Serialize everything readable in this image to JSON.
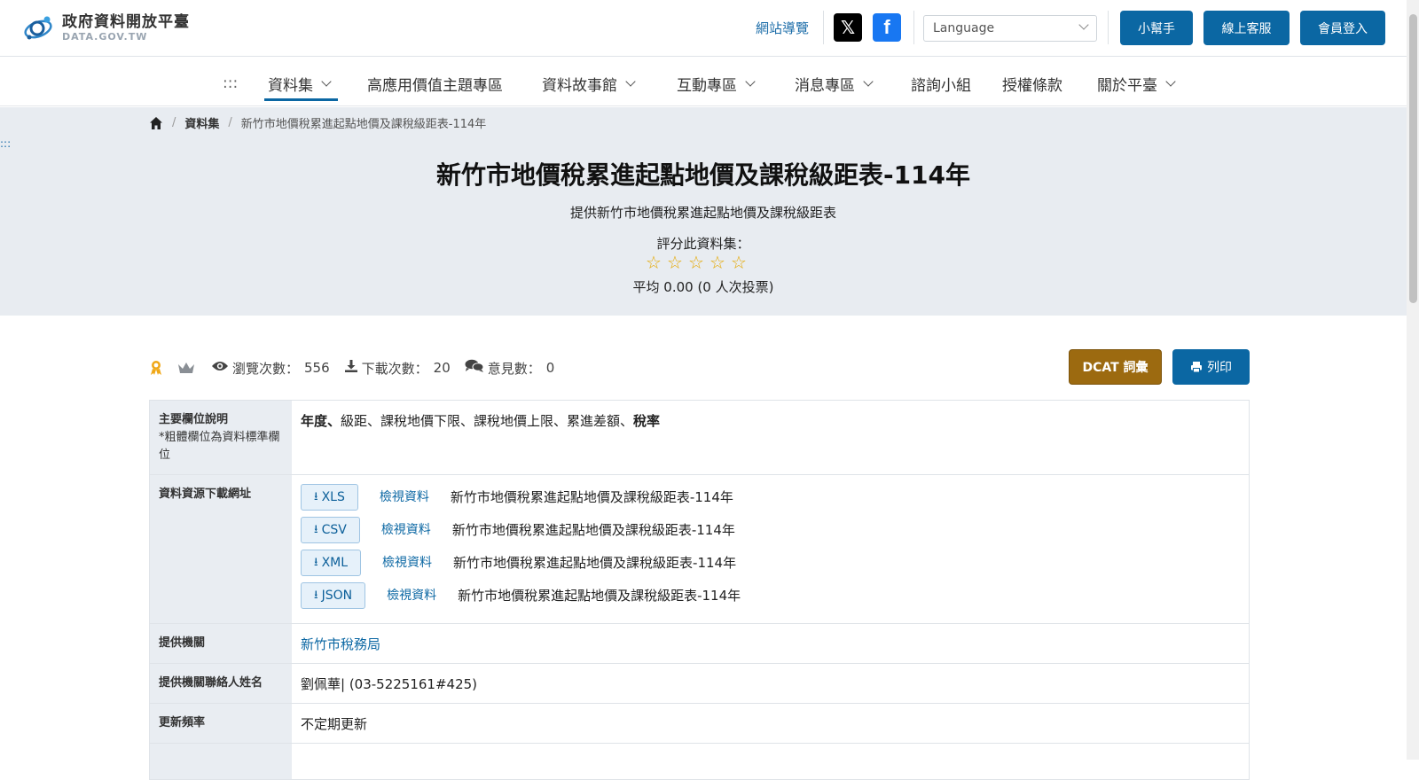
{
  "header": {
    "logo_zh": "政府資料開放平臺",
    "logo_en": "DATA.GOV.TW",
    "sitemap": "網站導覽",
    "social_x": "𝕏",
    "social_fb": "f",
    "language_placeholder": "Language",
    "btn_helper": "小幫手",
    "btn_service": "線上客服",
    "btn_login": "會員登入"
  },
  "nav": {
    "accesskey": ":::",
    "items": [
      "資料集",
      "高應用價值主題專區",
      "資料故事館",
      "互動專區",
      "消息專區",
      "諮詢小組",
      "授權條款",
      "關於平臺"
    ]
  },
  "breadcrumb": {
    "level1": "資料集",
    "current": "新竹市地價稅累進起點地價及課稅級距表-114年"
  },
  "skip_anchor": ":::",
  "hero": {
    "title": "新竹市地價稅累進起點地價及課稅級距表-114年",
    "description": "提供新竹市地價稅累進起點地價及課稅級距表",
    "rate_label": "評分此資料集：",
    "average": "平均 0.00 (0 人次投票)",
    "stars": 0
  },
  "stats": {
    "views_label": "瀏覽次數：",
    "views": "556",
    "downloads_label": "下載次數：",
    "downloads": "20",
    "comments_label": "意見數：",
    "comments": "0",
    "btn_dcat": "DCAT 詞彙",
    "btn_print": "列印"
  },
  "info": {
    "fields": {
      "label": "主要欄位說明",
      "sub": "*粗體欄位為資料標準欄位",
      "bold1": "年度",
      "sep1": "、",
      "plain": "級距、課稅地價下限、課稅地價上限、累進差額、",
      "bold2": "稅率"
    },
    "resources": {
      "label": "資料資源下載網址",
      "view_label": "檢視資料",
      "items": [
        {
          "format": "XLS",
          "title": "新竹市地價稅累進起點地價及課稅級距表-114年"
        },
        {
          "format": "CSV",
          "title": "新竹市地價稅累進起點地價及課稅級距表-114年"
        },
        {
          "format": "XML",
          "title": "新竹市地價稅累進起點地價及課稅級距表-114年"
        },
        {
          "format": "JSON",
          "title": "新竹市地價稅累進起點地價及課稅級距表-114年"
        }
      ]
    },
    "provider_label": "提供機關",
    "provider": "新竹市稅務局",
    "contact_label": "提供機關聯絡人姓名",
    "contact": "劉佩華| (03-5225161#425)",
    "frequency_label": "更新頻率",
    "frequency": "不定期更新"
  }
}
